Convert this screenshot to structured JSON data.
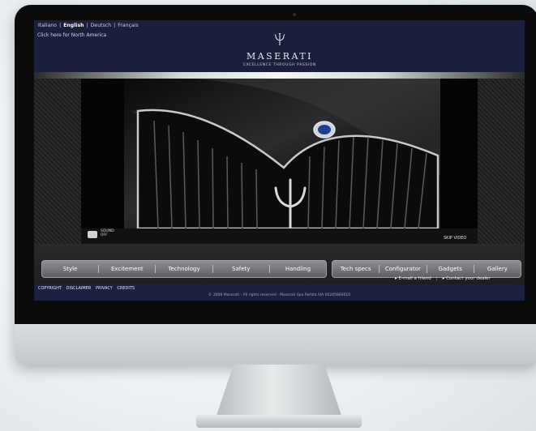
{
  "header": {
    "languages": [
      "Italiano",
      "English",
      "Deutsch",
      "Français"
    ],
    "active_language": "English",
    "region_link": "Click here for North America",
    "brand": "MASERATI",
    "tagline": "EXCELLENCE THROUGH PASSION"
  },
  "video": {
    "sound_label": "SOUND:\nOFF",
    "skip_label": "SKIP VIDEO"
  },
  "nav": {
    "main": [
      "Style",
      "Excitement",
      "Technology",
      "Safety",
      "Handling"
    ],
    "secondary": [
      "Tech specs",
      "Configurator",
      "Gadgets",
      "Gallery"
    ]
  },
  "footer": {
    "email_friend": "▸ E-mail a friend",
    "contact_dealer": "▸ Contact your dealer",
    "legal_links": [
      "COPYRIGHT",
      "DISCLAIMER",
      "PRIVACY",
      "CREDITS"
    ],
    "copyright": "© 2008 Maserati - All rights reserved - Maserati Spa Partita IVA 00245860010"
  },
  "colors": {
    "header_navy": "#1b1f3b",
    "nav_silver": "#7a7b7e",
    "strip_navy": "#1d2140"
  }
}
